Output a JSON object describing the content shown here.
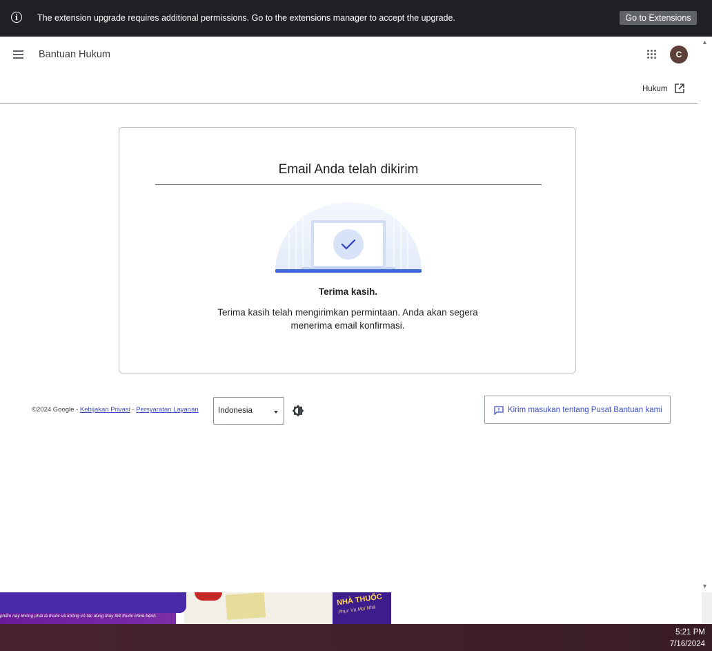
{
  "notification": {
    "message": "The extension upgrade requires additional permissions. Go to the extensions manager to accept the upgrade.",
    "button_label": "Go to Extensions",
    "icon": "info-icon"
  },
  "header": {
    "title": "Bantuan Hukum",
    "menu_icon": "menu-icon",
    "apps_icon": "apps-grid-icon",
    "avatar_letter": "C",
    "avatar_color": "#5d4037"
  },
  "subheader": {
    "link_label": "Hukum",
    "link_icon": "open-in-new-icon"
  },
  "card": {
    "title": "Email Anda telah dikirim",
    "thanks_title": "Terima kasih.",
    "thanks_text": "Terima kasih telah mengirimkan permintaan. Anda akan segera menerima email konfirmasi.",
    "illustration": "laptop-check-illustration"
  },
  "footer": {
    "copyright": "©2024 Google",
    "separator": " - ",
    "privacy_link": "Kebijakan Privasi",
    "terms_link": "Persyaratan Layanan",
    "language_selected": "Indonesia",
    "theme_icon": "dark-mode-toggle-icon",
    "feedback_label": "Kirim masukan tentang Pusat Bantuan kami",
    "feedback_icon": "feedback-icon"
  },
  "background_ad": {
    "note": "phẩm này không phải là thuốc và không có tác dụng thay thế thuốc chữa bệnh.",
    "brand": "NHÀ THUỐC",
    "brand_sub": "Phục Vụ Mọi Nhà"
  },
  "taskbar": {
    "time": "5:21 PM",
    "date": "7/16/2024"
  },
  "colors": {
    "notification_bg": "#202124",
    "link": "#3c4ec0",
    "accent_blue": "#3f68d8"
  }
}
